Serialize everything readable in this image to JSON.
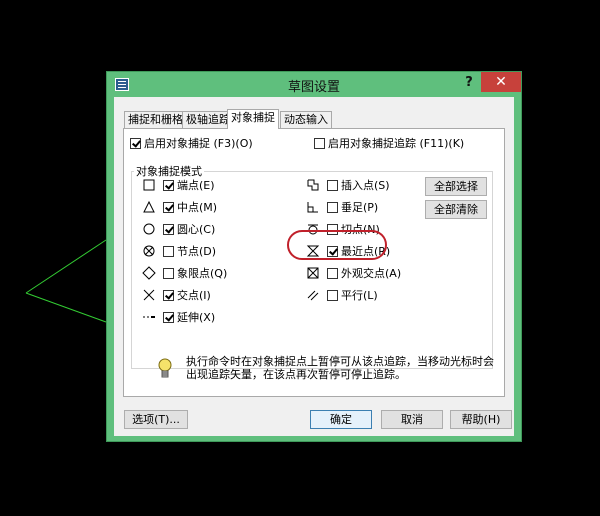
{
  "window": {
    "title": "草图设置",
    "help_label": "?",
    "close_label": "✕"
  },
  "tabs": [
    {
      "label": "捕捉和栅格"
    },
    {
      "label": "极轴追踪"
    },
    {
      "label": "对象捕捉"
    },
    {
      "label": "动态输入"
    }
  ],
  "osnap_on": {
    "label": "启用对象捕捉 (F3)(O)",
    "checked": true
  },
  "tracking_on": {
    "label": "启用对象捕捉追踪 (F11)(K)",
    "checked": false
  },
  "group_title": "对象捕捉模式",
  "modes_left": [
    {
      "label": "端点(E)",
      "checked": true,
      "icon": "endpoint-icon"
    },
    {
      "label": "中点(M)",
      "checked": true,
      "icon": "midpoint-icon"
    },
    {
      "label": "圆心(C)",
      "checked": true,
      "icon": "center-icon"
    },
    {
      "label": "节点(D)",
      "checked": false,
      "icon": "node-icon"
    },
    {
      "label": "象限点(Q)",
      "checked": false,
      "icon": "quadrant-icon"
    },
    {
      "label": "交点(I)",
      "checked": true,
      "icon": "intersection-icon"
    },
    {
      "label": "延伸(X)",
      "checked": true,
      "icon": "extension-icon"
    }
  ],
  "modes_right": [
    {
      "label": "插入点(S)",
      "checked": false,
      "icon": "insertion-icon"
    },
    {
      "label": "垂足(P)",
      "checked": false,
      "icon": "perpendicular-icon"
    },
    {
      "label": "切点(N)",
      "checked": false,
      "icon": "tangent-icon"
    },
    {
      "label": "最近点(R)",
      "checked": true,
      "icon": "nearest-icon"
    },
    {
      "label": "外观交点(A)",
      "checked": false,
      "icon": "apparent-intersection-icon"
    },
    {
      "label": "平行(L)",
      "checked": false,
      "icon": "parallel-icon"
    }
  ],
  "select_all_label": "全部选择",
  "clear_all_label": "全部清除",
  "info_text": "执行命令时在对象捕捉点上暂停可从该点追踪，当移动光标时会出现追踪矢量，在该点再次暂停可停止追踪。",
  "options_label": "选项(T)...",
  "ok_label": "确定",
  "cancel_label": "取消",
  "help_button_label": "帮助(H)",
  "colors": {
    "window_frame": "#5fbf7d",
    "close": "#c7413b",
    "highlight": "#c0202a",
    "bg_lines": "#33cc33"
  }
}
